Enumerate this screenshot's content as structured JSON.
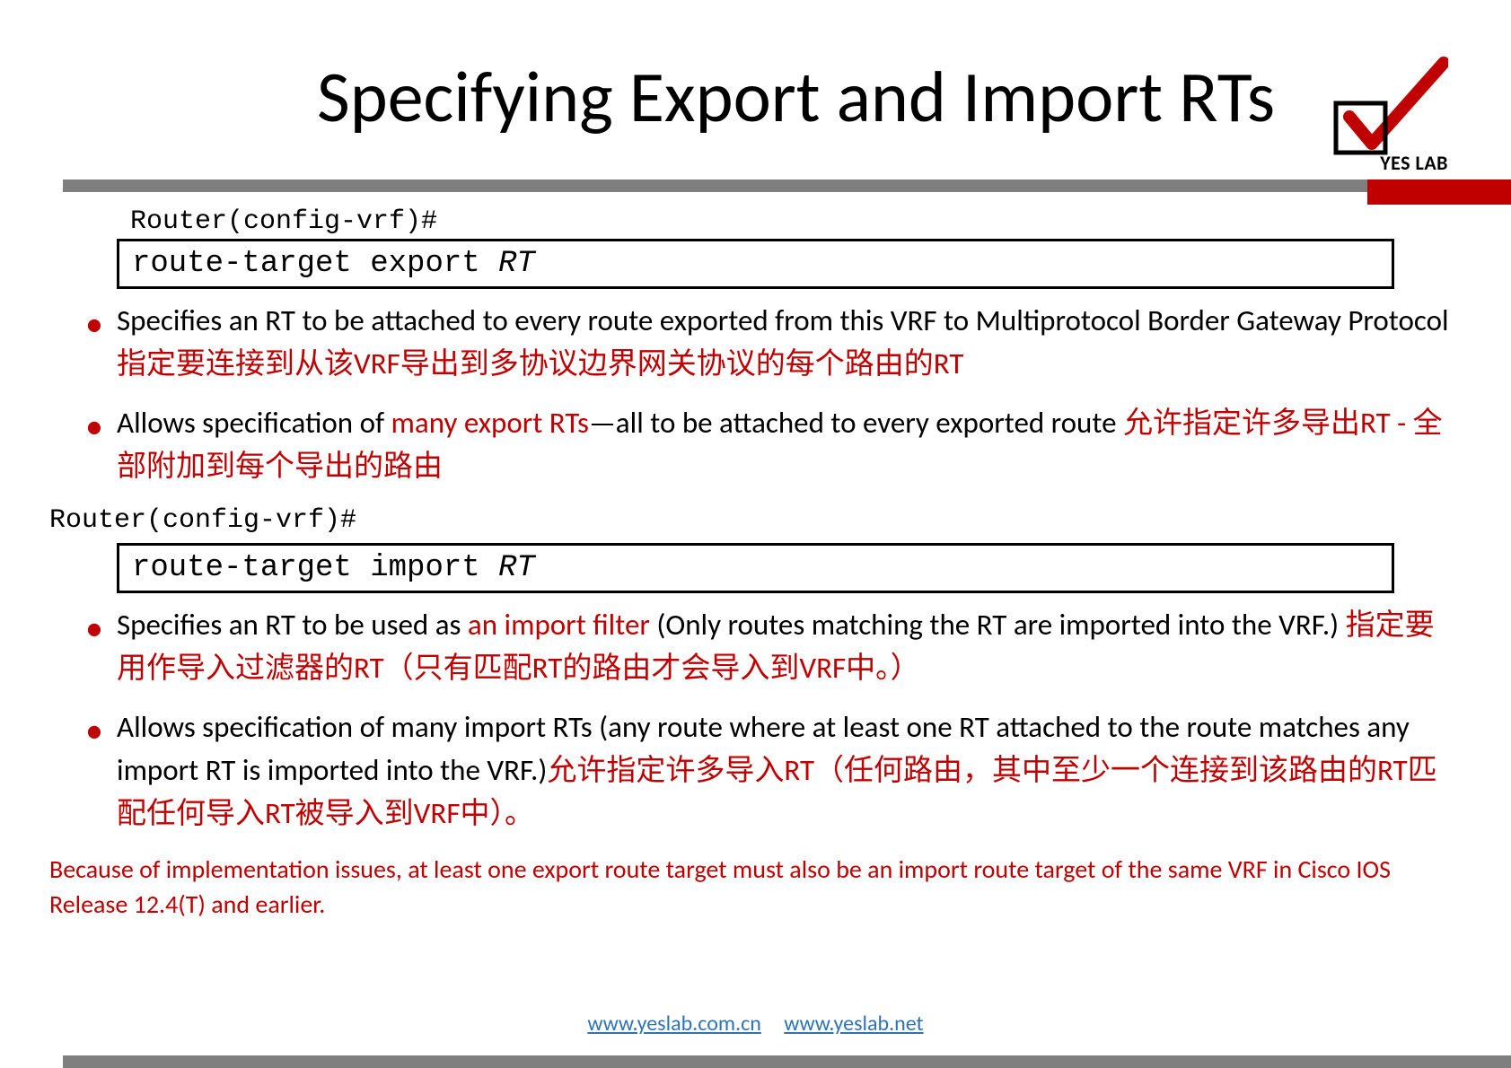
{
  "title": "Specifying Export and Import RTs",
  "logo": {
    "brand": "YES LAB"
  },
  "code_blocks": {
    "prompt1": "Router(config-vrf)#",
    "cmd1": "route-target export ",
    "param1": "RT",
    "prompt2": "Router(config-vrf)#",
    "cmd2": "route-target import ",
    "param2": "RT"
  },
  "bullets_export": [
    {
      "en_a": "Specifies an RT to be attached to every route exported from this VRF  to Multiprotocol Border Gateway Protocol  ",
      "zh": "指定要连接到从该VRF导出到多协议边界网关协议的每个路由的RT"
    },
    {
      "en_a": "Allows specification of ",
      "en_red": "many export RTs",
      "en_b": "—all to be attached to every  exported route ",
      "zh": "允许指定许多导出RT - 全部附加到每个导出的路由"
    }
  ],
  "bullets_import": [
    {
      "en_a": "Specifies an RT to be used as ",
      "en_red": "an import filter",
      "en_b": " (Only routes matching the RT are imported into the VRF.) ",
      "zh": "指定要用作导入过滤器的RT（只有匹配RT的路由才会导入到VRF中。）"
    },
    {
      "en_a": "Allows specification of many import RTs (any route where at least one  RT attached to the route matches any import RT is imported into the  VRF.)",
      "zh": "允许指定许多导入RT（任何路由，其中至少一个连接到该路由的RT匹配任何导入RT被导入到VRF中）。"
    }
  ],
  "footnote": "Because of implementation issues, at least one export route target must also be an import  route target of the same VRF in Cisco IOS Release 12.4(T) and earlier.",
  "links": {
    "a": "www.yeslab.com.cn",
    "b": "www.yeslab.net"
  }
}
